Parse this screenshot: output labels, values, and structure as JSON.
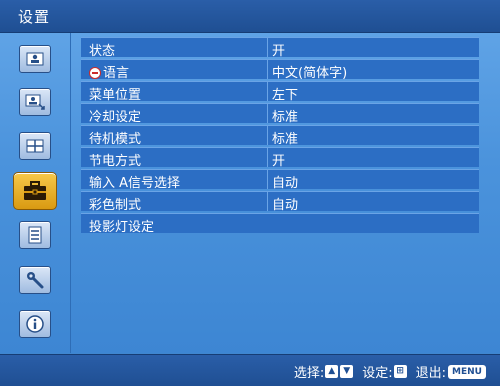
{
  "window": {
    "title": "设置"
  },
  "sidebar": {
    "items": [
      {
        "icon": "picture-icon",
        "active": false
      },
      {
        "icon": "picture-adjust-icon",
        "active": false
      },
      {
        "icon": "screen-layout-icon",
        "active": false
      },
      {
        "icon": "toolbox-icon",
        "active": true
      },
      {
        "icon": "list-icon",
        "active": false
      },
      {
        "icon": "wrench-icon",
        "active": false
      },
      {
        "icon": "info-icon",
        "active": false
      }
    ]
  },
  "menu": {
    "rows": [
      {
        "label": "状态",
        "value": "开"
      },
      {
        "label": "语言",
        "value": "中文(简体字)",
        "icon": "language-globe-icon"
      },
      {
        "label": "菜单位置",
        "value": "左下"
      },
      {
        "label": "冷却设定",
        "value": "标准"
      },
      {
        "label": "待机模式",
        "value": "标准"
      },
      {
        "label": "节电方式",
        "value": "开"
      },
      {
        "label": "输入 A信号选择",
        "value": "自动"
      },
      {
        "label": "彩色制式",
        "value": "自动"
      },
      {
        "label": "投影灯设定",
        "value": ""
      }
    ]
  },
  "footer": {
    "select_label": "选择:",
    "select_keys": [
      "▲",
      "▼"
    ],
    "set_label": "设定:",
    "set_key": "⊞",
    "exit_label": "退出:",
    "exit_key": "MENU"
  },
  "colors": {
    "accent_active": "#e8b02a",
    "row_bg": "#2c6ec4",
    "bar_bg": "#1f4f93"
  }
}
